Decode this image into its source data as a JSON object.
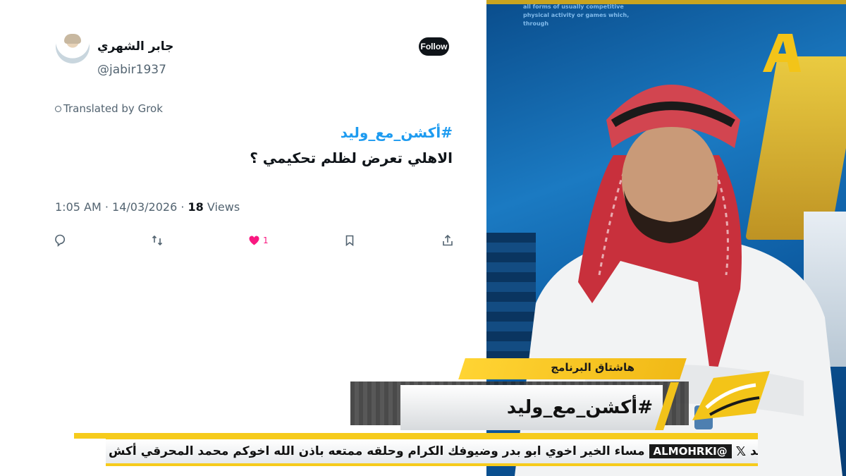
{
  "tweet": {
    "display_name": "جابر الشهري",
    "handle": "@jabir1937",
    "follow_label": "Follow",
    "translated_label": "Translated by Grok",
    "hashtag": "#أكشن_مع_وليد",
    "text": "الاهلي تعرض لظلم تحكيمي ؟",
    "time": "1:05 AM",
    "date": "14/03/2026",
    "views_count": "18",
    "views_label": "Views",
    "likes": "1"
  },
  "broadcast": {
    "bg_text": "all forms of usually competitive physical activity or games which, through",
    "hashtag_label": "هاشتاق البرنامج",
    "hashtag": "#أكشن_مع_وليد",
    "ticker_prefix": "ن_مع_وليد",
    "ticker_handle": "@ALMOHRKI",
    "ticker_message": "مساء الخير اخوي ابو بدر وضيوفك الكرام وحلقه ممتعه باذن الله اخوكم محمد المحرقي",
    "ticker_suffix": "أكش"
  },
  "colors": {
    "accent_yellow": "#f6cb1c",
    "link_blue": "#1d9bf0",
    "like_pink": "#f91880"
  }
}
